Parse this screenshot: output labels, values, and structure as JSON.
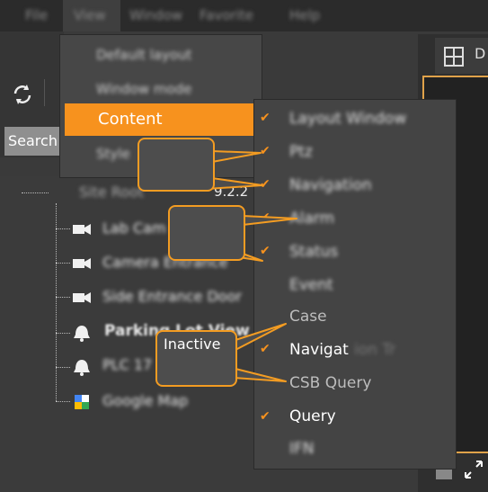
{
  "menubar": {
    "items": [
      "File",
      "View",
      "Window",
      "Favorite",
      "Help"
    ]
  },
  "toolbar": {
    "search_label": "Search"
  },
  "main_menu": {
    "items": [
      "Default layout",
      "Window mode",
      "Content",
      "Style"
    ],
    "highlighted": "Content"
  },
  "submenu": {
    "items": [
      {
        "label": "Layout Window",
        "checked": true
      },
      {
        "label": "Ptz",
        "checked": true
      },
      {
        "label": "Navigation",
        "checked": true
      },
      {
        "label": "Alarm",
        "checked": true
      },
      {
        "label": "Status",
        "checked": true
      },
      {
        "label": "Event",
        "checked": false
      },
      {
        "label": "Case",
        "checked": false
      },
      {
        "label": "Navigat",
        "checked": true
      },
      {
        "label": "CSB Query",
        "checked": false
      },
      {
        "label": "Query",
        "checked": true
      },
      {
        "label": "IFN",
        "checked": false
      }
    ]
  },
  "tree": {
    "root_suffix": "9.2.2",
    "items": [
      {
        "label": "Lab Cam 1",
        "icon": "camera-icon"
      },
      {
        "label": "Camera Entrance",
        "icon": "camera-icon"
      },
      {
        "label": "Side Entrance Door",
        "icon": "camera-icon"
      },
      {
        "label": "Parking Lot View",
        "icon": "alarm-bell-icon"
      },
      {
        "label": "PLC 17",
        "icon": "alarm-bell-icon"
      },
      {
        "label": "Google Map",
        "icon": "map-icon"
      }
    ]
  },
  "callouts": {
    "inactive": "Inactive"
  },
  "right_panel": {
    "tab_label": "D"
  },
  "colors": {
    "accent": "#f7921e",
    "callout_border": "#f39c22",
    "menu_bg": "#474747"
  }
}
